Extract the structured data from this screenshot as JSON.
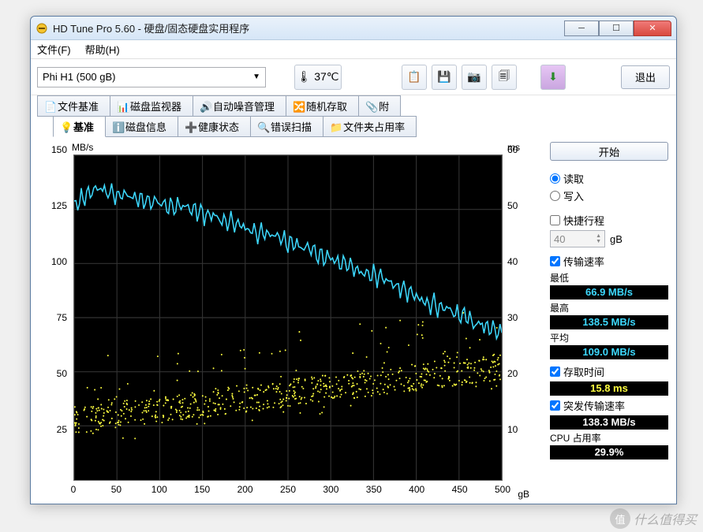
{
  "window": {
    "title": "HD Tune Pro 5.60 - 硬盘/固态硬盘实用程序"
  },
  "menu": {
    "file": "文件(F)",
    "help": "帮助(H)"
  },
  "toolbar": {
    "drive": "Phi   H1 (500 gB)",
    "temp": "37℃",
    "exit": "退出"
  },
  "tabs_top": [
    {
      "label": "文件基准"
    },
    {
      "label": "磁盘监视器"
    },
    {
      "label": "自动噪音管理"
    },
    {
      "label": "随机存取"
    },
    {
      "label": "附"
    }
  ],
  "tabs_bottom": [
    {
      "label": "基准",
      "active": true
    },
    {
      "label": "磁盘信息"
    },
    {
      "label": "健康状态"
    },
    {
      "label": "错误扫描"
    },
    {
      "label": "文件夹占用率"
    }
  ],
  "side": {
    "start": "开始",
    "read": "读取",
    "write": "写入",
    "shortstroke": "快捷行程",
    "shortstroke_val": "40",
    "shortstroke_unit": "gB",
    "tr_label": "传输速率",
    "min_label": "最低",
    "min_val": "66.9 MB/s",
    "max_label": "最高",
    "max_val": "138.5 MB/s",
    "avg_label": "平均",
    "avg_val": "109.0 MB/s",
    "access_label": "存取时间",
    "access_val": "15.8 ms",
    "burst_label": "突发传输速率",
    "burst_val": "138.3 MB/s",
    "cpu_label": "CPU 占用率",
    "cpu_val": "29.9%"
  },
  "chart_data": {
    "type": "line+scatter",
    "title_left": "MB/s",
    "title_right": "ms",
    "x_unit": "gB",
    "xlim": [
      0,
      500
    ],
    "ylim_left": [
      0,
      150
    ],
    "ylim_right": [
      0,
      60
    ],
    "xticks": [
      0,
      50,
      100,
      150,
      200,
      250,
      300,
      350,
      400,
      450,
      500
    ],
    "yticks_left": [
      25,
      50,
      75,
      100,
      125,
      150
    ],
    "yticks_right": [
      10,
      20,
      30,
      40,
      50,
      60
    ],
    "series": [
      {
        "name": "transfer_rate",
        "axis": "left",
        "style": "line",
        "color": "#3dd9ff",
        "x": [
          0,
          25,
          50,
          75,
          100,
          125,
          150,
          175,
          200,
          225,
          250,
          275,
          300,
          325,
          350,
          375,
          400,
          425,
          450,
          475,
          500
        ],
        "y": [
          128,
          135,
          132,
          130,
          128,
          126,
          123,
          120,
          117,
          113,
          110,
          106,
          102,
          98,
          95,
          90,
          85,
          80,
          76,
          72,
          68
        ]
      },
      {
        "name": "access_time",
        "axis": "right",
        "style": "scatter",
        "color": "#ffff40",
        "approx_range_ms": [
          5,
          25
        ],
        "mean_ms": 15.8
      }
    ]
  },
  "watermark": "什么值得买"
}
